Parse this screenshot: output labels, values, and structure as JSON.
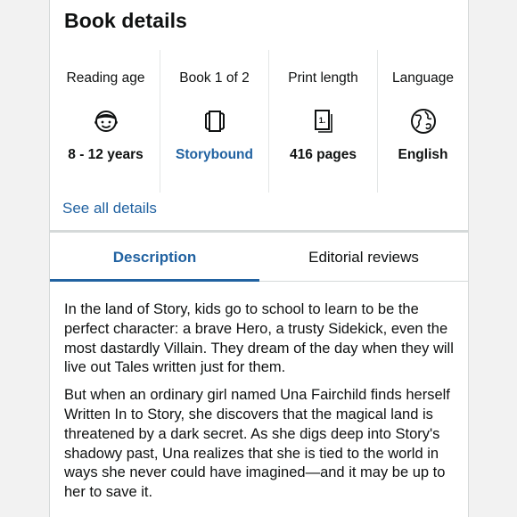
{
  "section": {
    "title": "Book details",
    "see_all_label": "See all details"
  },
  "details": [
    {
      "label": "Reading age",
      "icon": "child-face-icon",
      "value": "8 - 12 years",
      "link": false
    },
    {
      "label": "Book 1 of 2",
      "icon": "book-series-icon",
      "value": "Storybound",
      "link": true
    },
    {
      "label": "Print length",
      "icon": "pages-icon",
      "value": "416 pages",
      "link": false
    },
    {
      "label": "Language",
      "icon": "globe-icon",
      "value": "English",
      "link": false
    }
  ],
  "tabs": [
    {
      "label": "Description",
      "active": true
    },
    {
      "label": "Editorial reviews",
      "active": false
    }
  ],
  "description": {
    "paragraphs": [
      "In the land of Story, kids go to school to learn to be the perfect character: a brave Hero, a trusty Sidekick, even the most dastardly Villain. They dream of the day when they will live out Tales written just for them.",
      "But when an ordinary girl named Una Fairchild finds herself Written In to Story, she discovers that the magical land is threatened by a dark secret. As she digs deep into Story's shadowy past, Una realizes that she is tied to the world in ways she never could have imagined—and it may be up to her to save it."
    ]
  },
  "colors": {
    "link": "#2162a1",
    "text": "#0f1111",
    "divider": "#d5d9d9"
  }
}
